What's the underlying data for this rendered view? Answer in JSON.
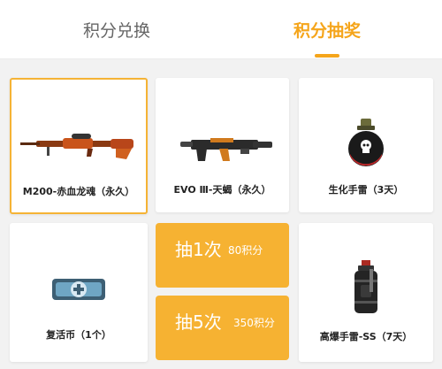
{
  "tabs": {
    "exchange": "积分兑换",
    "lottery": "积分抽奖"
  },
  "colors": {
    "accent": "#f5a51b",
    "button_bg": "#f6b232",
    "selected_border": "#f5b335"
  },
  "prizes": [
    {
      "label": "M200-赤血龙魂（永久）",
      "icon": "sniper-rifle-icon"
    },
    {
      "label": "EVO Ⅲ-天蝎（永久）",
      "icon": "assault-rifle-icon"
    },
    {
      "label": "生化手雷（3天）",
      "icon": "bio-grenade-icon"
    },
    {
      "label": "复活币（1个）",
      "icon": "revive-coin-icon"
    },
    {
      "label": "高爆手雷-SS（7天）",
      "icon": "he-grenade-icon"
    }
  ],
  "draw": [
    {
      "label": "抽1次",
      "cost": "80积分"
    },
    {
      "label": "抽5次",
      "cost": "350积分"
    }
  ]
}
